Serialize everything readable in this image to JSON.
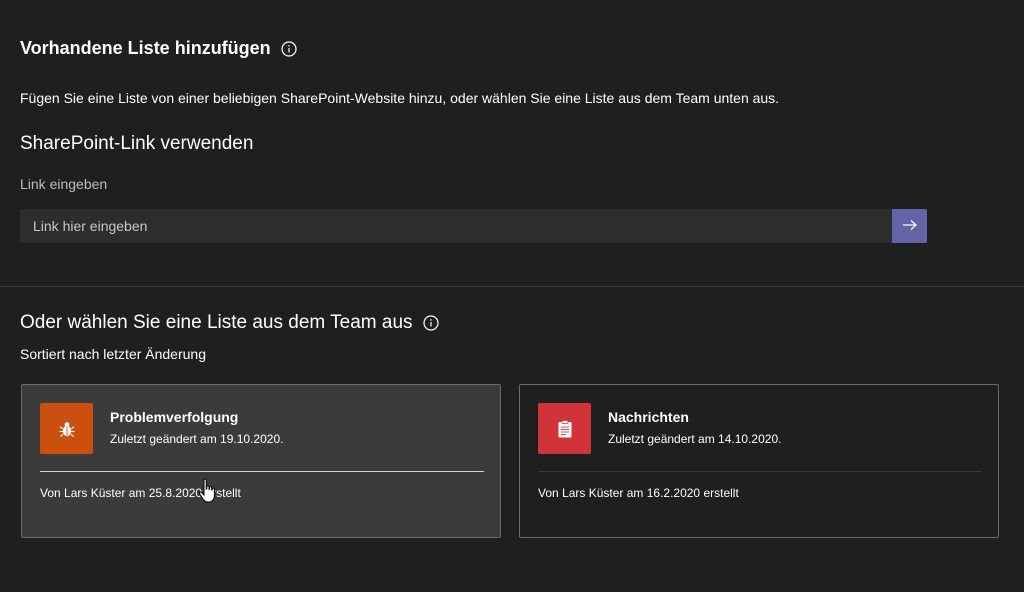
{
  "header": {
    "title": "Vorhandene Liste hinzufügen",
    "description": "Fügen Sie eine Liste von einer beliebigen SharePoint-Website hinzu, oder wählen Sie eine Liste aus dem Team unten aus."
  },
  "sharepoint": {
    "heading": "SharePoint-Link verwenden",
    "field_label": "Link eingeben",
    "input_placeholder": "Link hier eingeben",
    "input_value": ""
  },
  "team": {
    "heading": "Oder wählen Sie eine Liste aus dem Team aus",
    "sort_label": "Sortiert nach letzter Änderung",
    "lists": [
      {
        "title": "Problemverfolgung",
        "modified": "Zuletzt geändert am 19.10.2020.",
        "created": "Von Lars Küster am 25.8.2020 erstellt",
        "icon": "bug-icon",
        "icon_color": "#ca5010",
        "hovered": true
      },
      {
        "title": "Nachrichten",
        "modified": "Zuletzt geändert am 14.10.2020.",
        "created": "Von Lars Küster am 16.2.2020 erstellt",
        "icon": "clipboard-icon",
        "icon_color": "#d13438",
        "hovered": false
      }
    ]
  },
  "colors": {
    "accent": "#6264a7",
    "background": "#1f1f1f",
    "input_background": "#2d2d2d",
    "card_hover_background": "#3b3b3b"
  }
}
